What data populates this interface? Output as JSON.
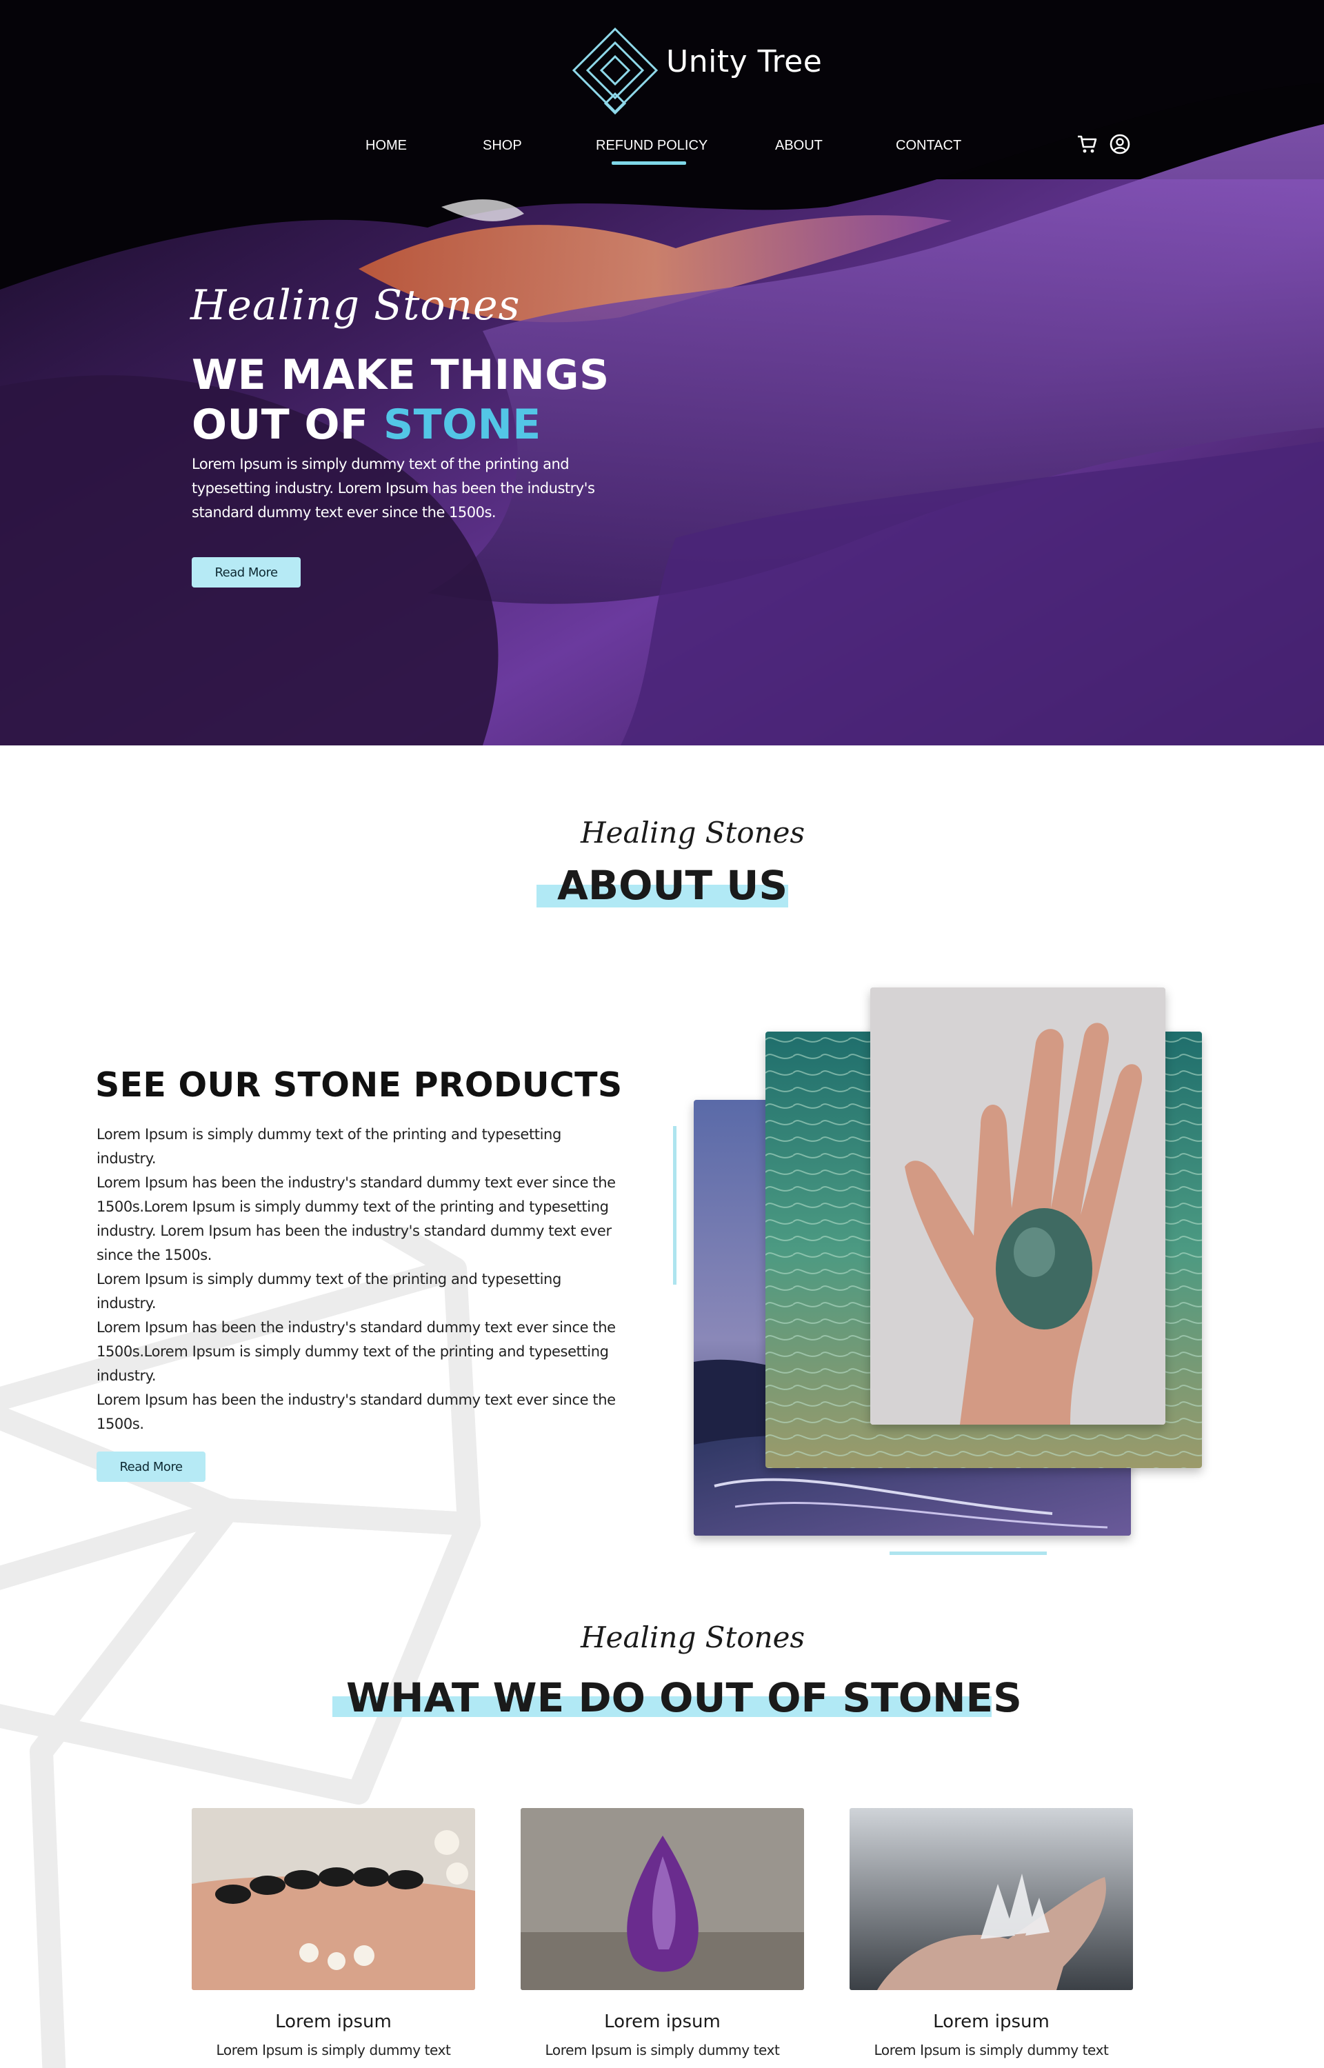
{
  "brand": {
    "name": "Unity Tree",
    "logo_icon": "diamond-logo-icon"
  },
  "nav": {
    "items": [
      {
        "label": "HOME"
      },
      {
        "label": "SHOP"
      },
      {
        "label": "REFUND POLICY",
        "active": true
      },
      {
        "label": "ABOUT"
      },
      {
        "label": "CONTACT"
      }
    ],
    "icons": [
      "cart-icon",
      "user-icon"
    ]
  },
  "hero": {
    "script": "Healing Stones",
    "headline_line1": "WE MAKE THINGS",
    "headline_line2_prefix": "OUT OF ",
    "headline_line2_accent": "STONE",
    "body": "Lorem Ipsum is simply dummy text of the printing and typesetting industry. Lorem Ipsum has been the industry's standard dummy text ever since the 1500s.",
    "button": "Read More"
  },
  "about": {
    "script": "Healing Stones",
    "title": "ABOUT US",
    "heading": "SEE OUR STONE PRODUCTS",
    "paragraph1": "Lorem Ipsum is simply dummy text of the printing and typesetting industry.\nLorem Ipsum has been the industry's standard dummy text ever since the\n1500s.Lorem Ipsum is simply dummy text of the printing and typesetting\nindustry. Lorem Ipsum has been the industry's standard dummy text ever\nsince the 1500s.",
    "paragraph2": "Lorem Ipsum is simply dummy text of the printing and typesetting industry.\nLorem Ipsum has been the industry's standard dummy text ever since the\n1500s.Lorem Ipsum is simply dummy text of the printing and typesetting\nindustry.\nLorem Ipsum has been the industry's standard dummy text ever since the\n1500s.",
    "button": "Read More"
  },
  "services": {
    "script": "Healing Stones",
    "title": "WHAT WE DO OUT OF STONES",
    "cards": [
      {
        "title": "Lorem ipsum",
        "text": "Lorem Ipsum is simply dummy text"
      },
      {
        "title": "Lorem ipsum",
        "text": "Lorem Ipsum is simply dummy text"
      },
      {
        "title": "Lorem ipsum",
        "text": "Lorem Ipsum is simply dummy text"
      }
    ]
  },
  "colors": {
    "accent": "#53c6e6",
    "highlight": "#b1e9f5",
    "dark": "#1a1a1a"
  }
}
